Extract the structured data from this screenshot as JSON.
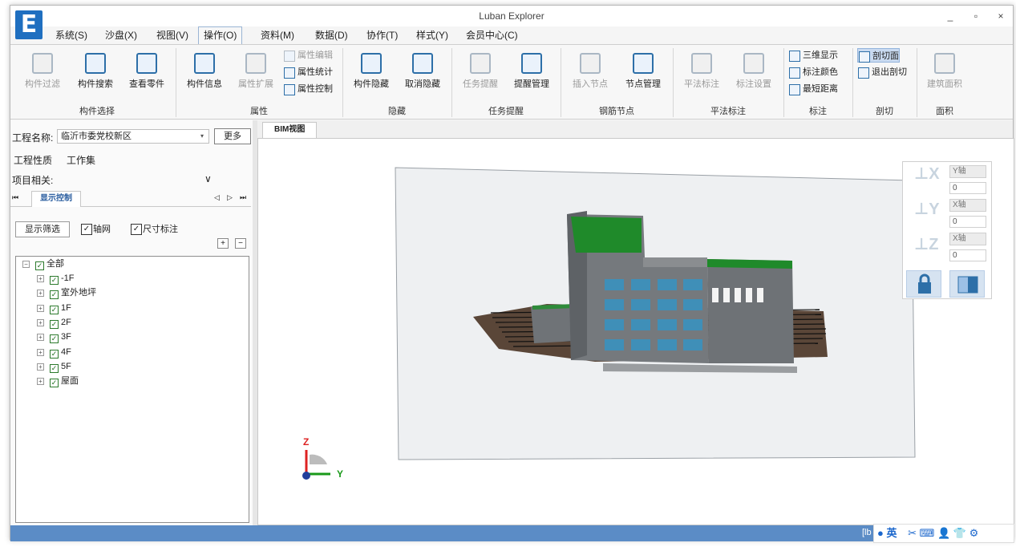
{
  "window": {
    "title": "Luban Explorer",
    "minimize": "_",
    "restore": "▫",
    "close": "×"
  },
  "logo": {
    "letter": "E"
  },
  "menu": [
    "系统(S)",
    "沙盘(X)",
    "视图(V)",
    "操作(O)",
    "资料(M)",
    "数据(D)",
    "协作(T)",
    "样式(Y)",
    "会员中心(C)"
  ],
  "menu_active": 3,
  "ribbon": {
    "buttons": [
      "构件过滤",
      "构件搜索",
      "查看零件",
      "构件信息",
      "属性扩展",
      "构件隐藏",
      "取消隐藏",
      "任务提醒",
      "提醒管理",
      "插入节点",
      "节点管理",
      "平法标注",
      "标注设置",
      "建筑面积"
    ],
    "small": [
      "属性编辑",
      "属性统计",
      "属性控制",
      "三维显示",
      "标注颜色",
      "最短距离",
      "剖切面",
      "退出剖切"
    ],
    "groups": [
      "构件选择",
      "属性",
      "隐藏",
      "任务提醒",
      "钢筋节点",
      "平法标注",
      "标注",
      "剖切",
      "面积"
    ]
  },
  "left": {
    "project_label": "工程名称:",
    "project_value": "临沂市委党校新区",
    "more": "更多",
    "tab_properties": "工程性质",
    "tab_workset": "工作集",
    "related_label": "项目相关:",
    "related_chevron": "∨",
    "display_tab": "显示控制",
    "nav_first": "⏮",
    "nav_prev": "◁",
    "nav_next": "▷",
    "nav_last": "⏭",
    "filter_button": "显示筛选",
    "chk_axis": "轴网",
    "chk_dim": "尺寸标注",
    "plus": "+",
    "minus": "−",
    "tree": [
      "全部",
      "-1F",
      "室外地坪",
      "1F",
      "2F",
      "3F",
      "4F",
      "5F",
      "屋面"
    ]
  },
  "view": {
    "tab": "BIM视图",
    "axis_z": "Z",
    "axis_y": "Y"
  },
  "section_panel": {
    "sel1": "Y轴",
    "val1": "0",
    "sel2": "X轴",
    "val2": "0",
    "sel3": "X轴",
    "val3": "0"
  },
  "status": {
    "text": "[lb",
    "ime_lang": "英"
  },
  "colors": {
    "accent": "#2d6fa8",
    "statusbar": "#5b8cc6",
    "roof_green": "#1f8a2a"
  }
}
